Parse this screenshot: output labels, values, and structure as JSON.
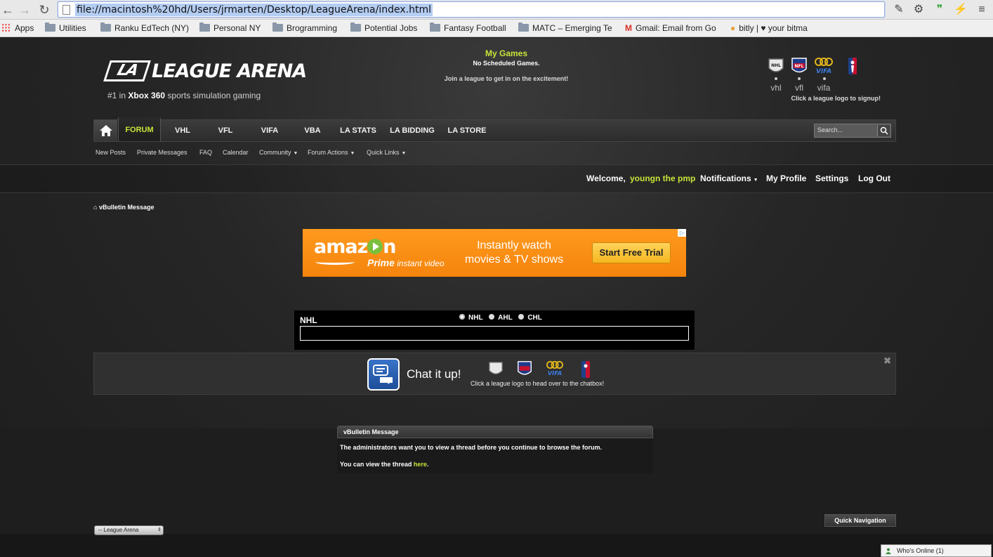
{
  "browser": {
    "url": "file://macintosh%20hd/Users/jrmarten/Desktop/LeagueArena/index.html",
    "bookmarks": [
      "Apps",
      "Utilities",
      "Ranku EdTech (NY)",
      "Personal NY",
      "Brogramming",
      "Potential Jobs",
      "Fantasy Football",
      "MATC – Emerging Te",
      "Gmail: Email from Go",
      "bitly | ♥ your bitma"
    ]
  },
  "header": {
    "logo_mark": "LA",
    "logo_text": "LEAGUE ARENA",
    "tagline_prefix": "#1 in ",
    "tagline_bold": "Xbox 360",
    "tagline_suffix": " sports simulation gaming",
    "my_games_title": "My Games",
    "my_games_status": "No Scheduled Games.",
    "my_games_join": "Join a league to get in on the excitement!",
    "leagues": [
      {
        "abbr": "NHL",
        "caption": "vhl",
        "color": "#cfcfcf"
      },
      {
        "abbr": "NFL",
        "caption": "vfl",
        "color": "#c8102e"
      },
      {
        "abbr": "VIFA",
        "caption": "vifa",
        "color": "#2a62c9"
      },
      {
        "abbr": "NBA",
        "caption": "",
        "color": "#c8102e"
      }
    ],
    "signup_text": "Click a league logo to signup!"
  },
  "nav": {
    "items": [
      "FORUM",
      "VHL",
      "VFL",
      "VIFA",
      "VBA",
      "LA STATS",
      "LA BIDDING",
      "LA STORE"
    ],
    "search_placeholder": "Search...",
    "sub": [
      "New Posts",
      "Private Messages",
      "FAQ",
      "Calendar",
      "Community",
      "Forum Actions",
      "Quick Links"
    ]
  },
  "userbar": {
    "welcome": "Welcome,",
    "username": "youngn the pmp",
    "notifications": "Notifications",
    "my_profile": "My Profile",
    "settings": "Settings",
    "log_out": "Log Out"
  },
  "breadcrumb": "vBulletin Message",
  "ad": {
    "brand": "amaz",
    "brand_end": "n",
    "prime_bold": "Prime",
    "prime_rest": " instant video",
    "message_line1": "Instantly watch",
    "message_line2": "movies & TV shows",
    "cta": "Start Free Trial",
    "adchoices": "▷"
  },
  "scores": {
    "title": "NHL",
    "options": [
      "NHL",
      "AHL",
      "CHL"
    ],
    "selected": "NHL"
  },
  "chat": {
    "title": "Chat it up!",
    "hint": "Click a league logo to head over to the chatbox!",
    "close": "✖"
  },
  "message": {
    "header": "vBulletin Message",
    "line1": "The administrators want you to view a thread before you continue to browse the forum.",
    "line2_prefix": "You can view the thread ",
    "line2_link": "here",
    "line2_suffix": "."
  },
  "footer": {
    "forum_select": "-- League Arena",
    "quick_nav": "Quick Navigation",
    "whos_online": "Who's Online (1)"
  }
}
